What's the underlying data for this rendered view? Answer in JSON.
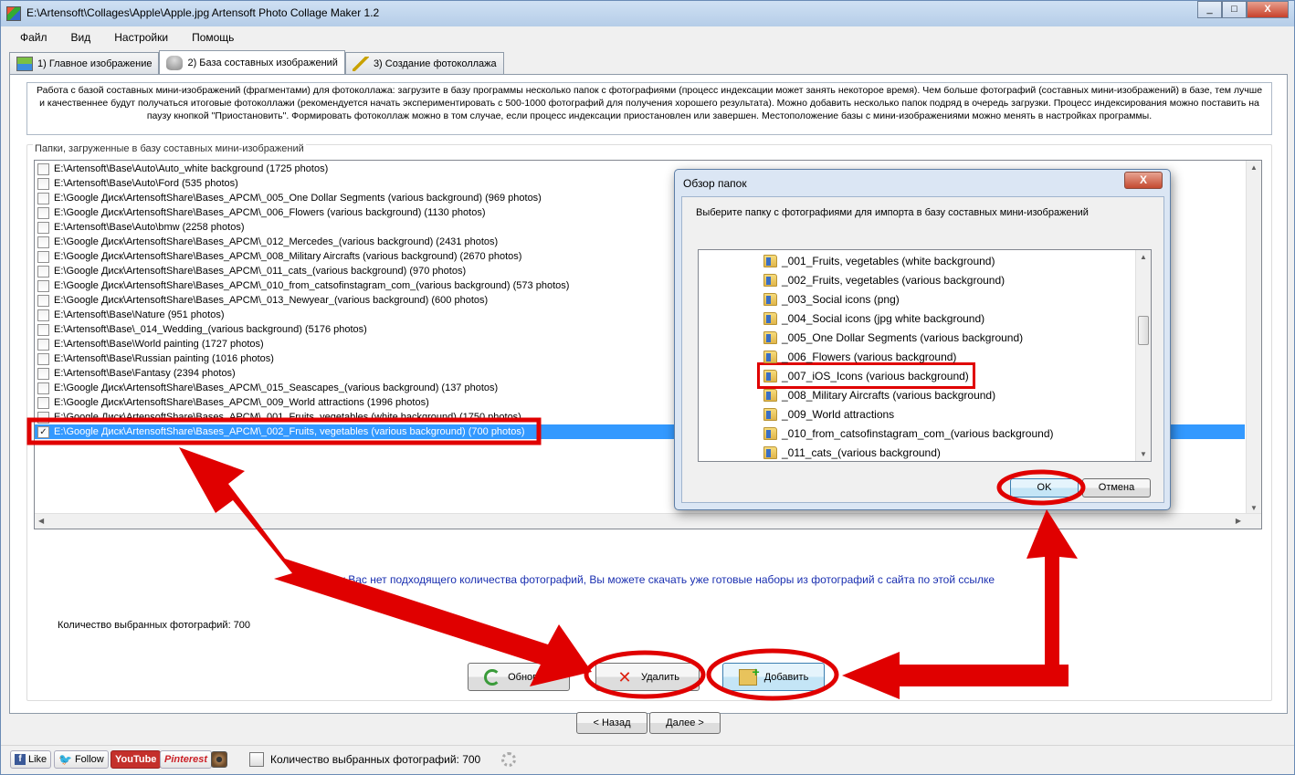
{
  "window": {
    "title": "E:\\Artensoft\\Collages\\Apple\\Apple.jpg Artensoft Photo Collage Maker 1.2",
    "controls": [
      "_",
      "□",
      "X"
    ]
  },
  "menu": [
    "Файл",
    "Вид",
    "Настройки",
    "Помощь"
  ],
  "tabs": [
    {
      "label": "1) Главное изображение",
      "icon": "image-icon"
    },
    {
      "label": "2) База составных изображений",
      "icon": "database-icon",
      "active": true
    },
    {
      "label": "3) Создание фотоколлажа",
      "icon": "magic-wand-icon"
    }
  ],
  "info_text": "Работа с базой составных мини-изображений (фрагментами) для фотоколлажа: загрузите в базу программы несколько папок с фотографиями (процесс индексации может занять некоторое время). Чем больше фотографий (составных мини-изображений) в базе, тем лучше и качественнее будут получаться итоговые фотоколлажи (рекомендуется начать экспериментировать с 500-1000 фотографий для получения хорошего результата). Можно добавить несколько папок подряд в очередь загрузки. Процесс индексирования можно поставить на паузу кнопкой \"Приостановить\". Формировать фотоколлаж можно в том случае, если процесс индексации приостановлен или завершен. Местоположение базы с мини-изображениями можно менять в настройках программы.",
  "folders_group": {
    "title": "Папки, загруженные в базу составных мини-изображений",
    "items": [
      {
        "path": "E:\\Artensoft\\Base\\Auto\\Auto_white background (1725 photos)",
        "checked": false
      },
      {
        "path": "E:\\Artensoft\\Base\\Auto\\Ford (535 photos)",
        "checked": false
      },
      {
        "path": "E:\\Google Диск\\ArtensoftShare\\Bases_APCM\\_005_One Dollar Segments (various background) (969 photos)",
        "checked": false
      },
      {
        "path": "E:\\Google Диск\\ArtensoftShare\\Bases_APCM\\_006_Flowers (various background) (1130 photos)",
        "checked": false
      },
      {
        "path": "E:\\Artensoft\\Base\\Auto\\bmw (2258 photos)",
        "checked": false
      },
      {
        "path": "E:\\Google Диск\\ArtensoftShare\\Bases_APCM\\_012_Mercedes_(various background) (2431 photos)",
        "checked": false
      },
      {
        "path": "E:\\Google Диск\\ArtensoftShare\\Bases_APCM\\_008_Military Aircrafts (various background) (2670 photos)",
        "checked": false
      },
      {
        "path": "E:\\Google Диск\\ArtensoftShare\\Bases_APCM\\_011_cats_(various background) (970 photos)",
        "checked": false
      },
      {
        "path": "E:\\Google Диск\\ArtensoftShare\\Bases_APCM\\_010_from_catsofinstagram_com_(various background) (573 photos)",
        "checked": false
      },
      {
        "path": "E:\\Google Диск\\ArtensoftShare\\Bases_APCM\\_013_Newyear_(various background) (600 photos)",
        "checked": false
      },
      {
        "path": "E:\\Artensoft\\Base\\Nature (951 photos)",
        "checked": false
      },
      {
        "path": "E:\\Artensoft\\Base\\_014_Wedding_(various background) (5176 photos)",
        "checked": false
      },
      {
        "path": "E:\\Artensoft\\Base\\World painting (1727 photos)",
        "checked": false
      },
      {
        "path": "E:\\Artensoft\\Base\\Russian painting (1016 photos)",
        "checked": false
      },
      {
        "path": "E:\\Artensoft\\Base\\Fantasy (2394 photos)",
        "checked": false
      },
      {
        "path": "E:\\Google Диск\\ArtensoftShare\\Bases_APCM\\_015_Seascapes_(various background) (137 photos)",
        "checked": false
      },
      {
        "path": "E:\\Google Диск\\ArtensoftShare\\Bases_APCM\\_009_World attractions (1996 photos)",
        "checked": false
      },
      {
        "path": "E:\\Google Диск\\ArtensoftShare\\Bases_APCM\\_001_Fruits, vegetables (white background) (1750 photos)",
        "checked": false
      },
      {
        "path": "E:\\Google Диск\\ArtensoftShare\\Bases_APCM\\_002_Fruits, vegetables (various background) (700 photos)",
        "checked": true,
        "selected": true
      }
    ]
  },
  "selected_count_label": "Количество выбранных фотографий: 700",
  "download_link_text": "Если у Вас нет подходящего количества фотографий, Вы можете скачать уже готовые наборы из фотографий с сайта по этой ссылке",
  "buttons": {
    "refresh": "Обновить",
    "delete": "Удалить",
    "add": "Добавить",
    "back": "< Назад",
    "next": "Далее >"
  },
  "statusbar": {
    "like": "Like",
    "follow": "Follow",
    "youtube": "YouTube",
    "pinterest": "Pinterest",
    "status_text": "Количество выбранных фотографий: 700"
  },
  "dialog": {
    "title": "Обзор папок",
    "close": "X",
    "description": "Выберите папку с фотографиями для импорта в базу составных мини-изображений",
    "folders": [
      "_001_Fruits, vegetables (white background)",
      "_002_Fruits, vegetables (various background)",
      "_003_Social icons (png)",
      "_004_Social icons (jpg white background)",
      "_005_One Dollar Segments (various background)",
      "_006_Flowers (various background)",
      "_007_iOS_Icons (various background)",
      "_008_Military Aircrafts (various background)",
      "_009_World attractions",
      "_010_from_catsofinstagram_com_(various background)",
      "_011_cats_(various background)"
    ],
    "highlighted_index": 6,
    "ok": "OK",
    "cancel": "Отмена"
  },
  "colors": {
    "selection": "#3399ff",
    "annotation": "#e00000",
    "link": "#1a2fb0"
  }
}
